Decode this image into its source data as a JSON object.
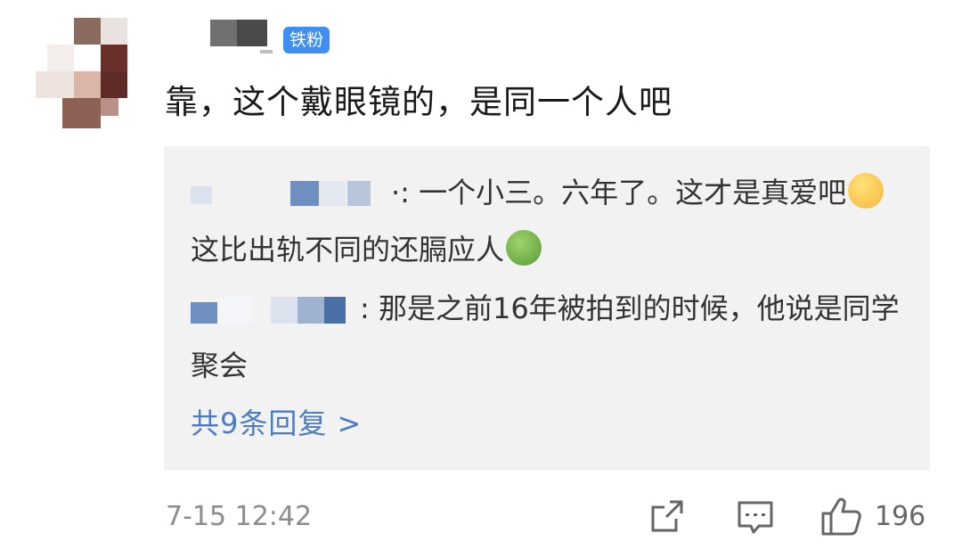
{
  "comment": {
    "badge": "铁粉",
    "text": "靠，这个戴眼镜的，是同一个人吧",
    "time": "7-15 12:42",
    "like_count": "196"
  },
  "replies": [
    {
      "user_suffix": "·:",
      "text_a": " 一个小三。六年了。这才是真爱吧",
      "text_b": "这比出轨不同的还膈应人"
    },
    {
      "user_suffix": ":",
      "text": " 那是之前16年被拍到的时候，他说是同学聚会"
    }
  ],
  "more_replies": "共9条回复 >",
  "icons": {
    "share": "share-icon",
    "comment": "comment-icon",
    "like": "thumbs-up-icon"
  },
  "colors": {
    "badge": "#3f8ff3",
    "link": "#4b7cc4",
    "reply_bg": "#f2f2f2"
  }
}
